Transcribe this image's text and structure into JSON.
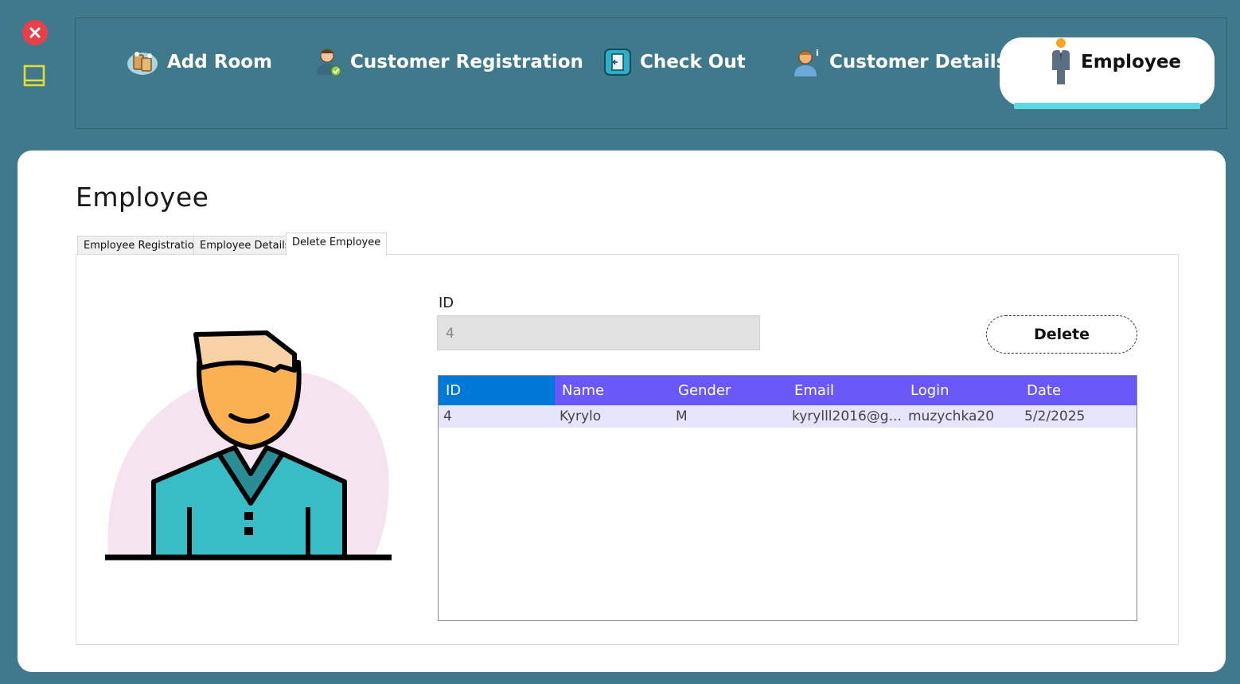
{
  "window": {
    "close_icon": "close-icon",
    "minimize_icon": "minimize-icon"
  },
  "nav": {
    "items": [
      {
        "label": "Add Room",
        "icon": "rooms-icon"
      },
      {
        "label": "Customer Registration",
        "icon": "customer-register-icon"
      },
      {
        "label": "Check Out",
        "icon": "checkout-door-icon"
      },
      {
        "label": "Customer Details",
        "icon": "customer-info-icon"
      },
      {
        "label": "Employee",
        "icon": "employee-icon",
        "active": true
      }
    ]
  },
  "page": {
    "title": "Employee"
  },
  "tabs": [
    {
      "label": "Employee Registration"
    },
    {
      "label": "Employee Details"
    },
    {
      "label": "Delete Employee",
      "active": true
    }
  ],
  "form": {
    "id_label": "ID",
    "id_value": "4",
    "delete_label": "Delete"
  },
  "grid": {
    "columns": [
      "ID",
      "Name",
      "Gender",
      "Email",
      "Login",
      "Date"
    ],
    "rows": [
      [
        "4",
        "Kyrylo",
        "M",
        "kyrylll2016@g...",
        "muzychka20",
        "5/2/2025"
      ]
    ]
  },
  "colors": {
    "background": "#40788c",
    "header_accent": "#6a57f7",
    "selected_header": "#0078d7",
    "row_highlight": "#e6e4fb",
    "active_tab_underline": "#5fd7e3"
  }
}
